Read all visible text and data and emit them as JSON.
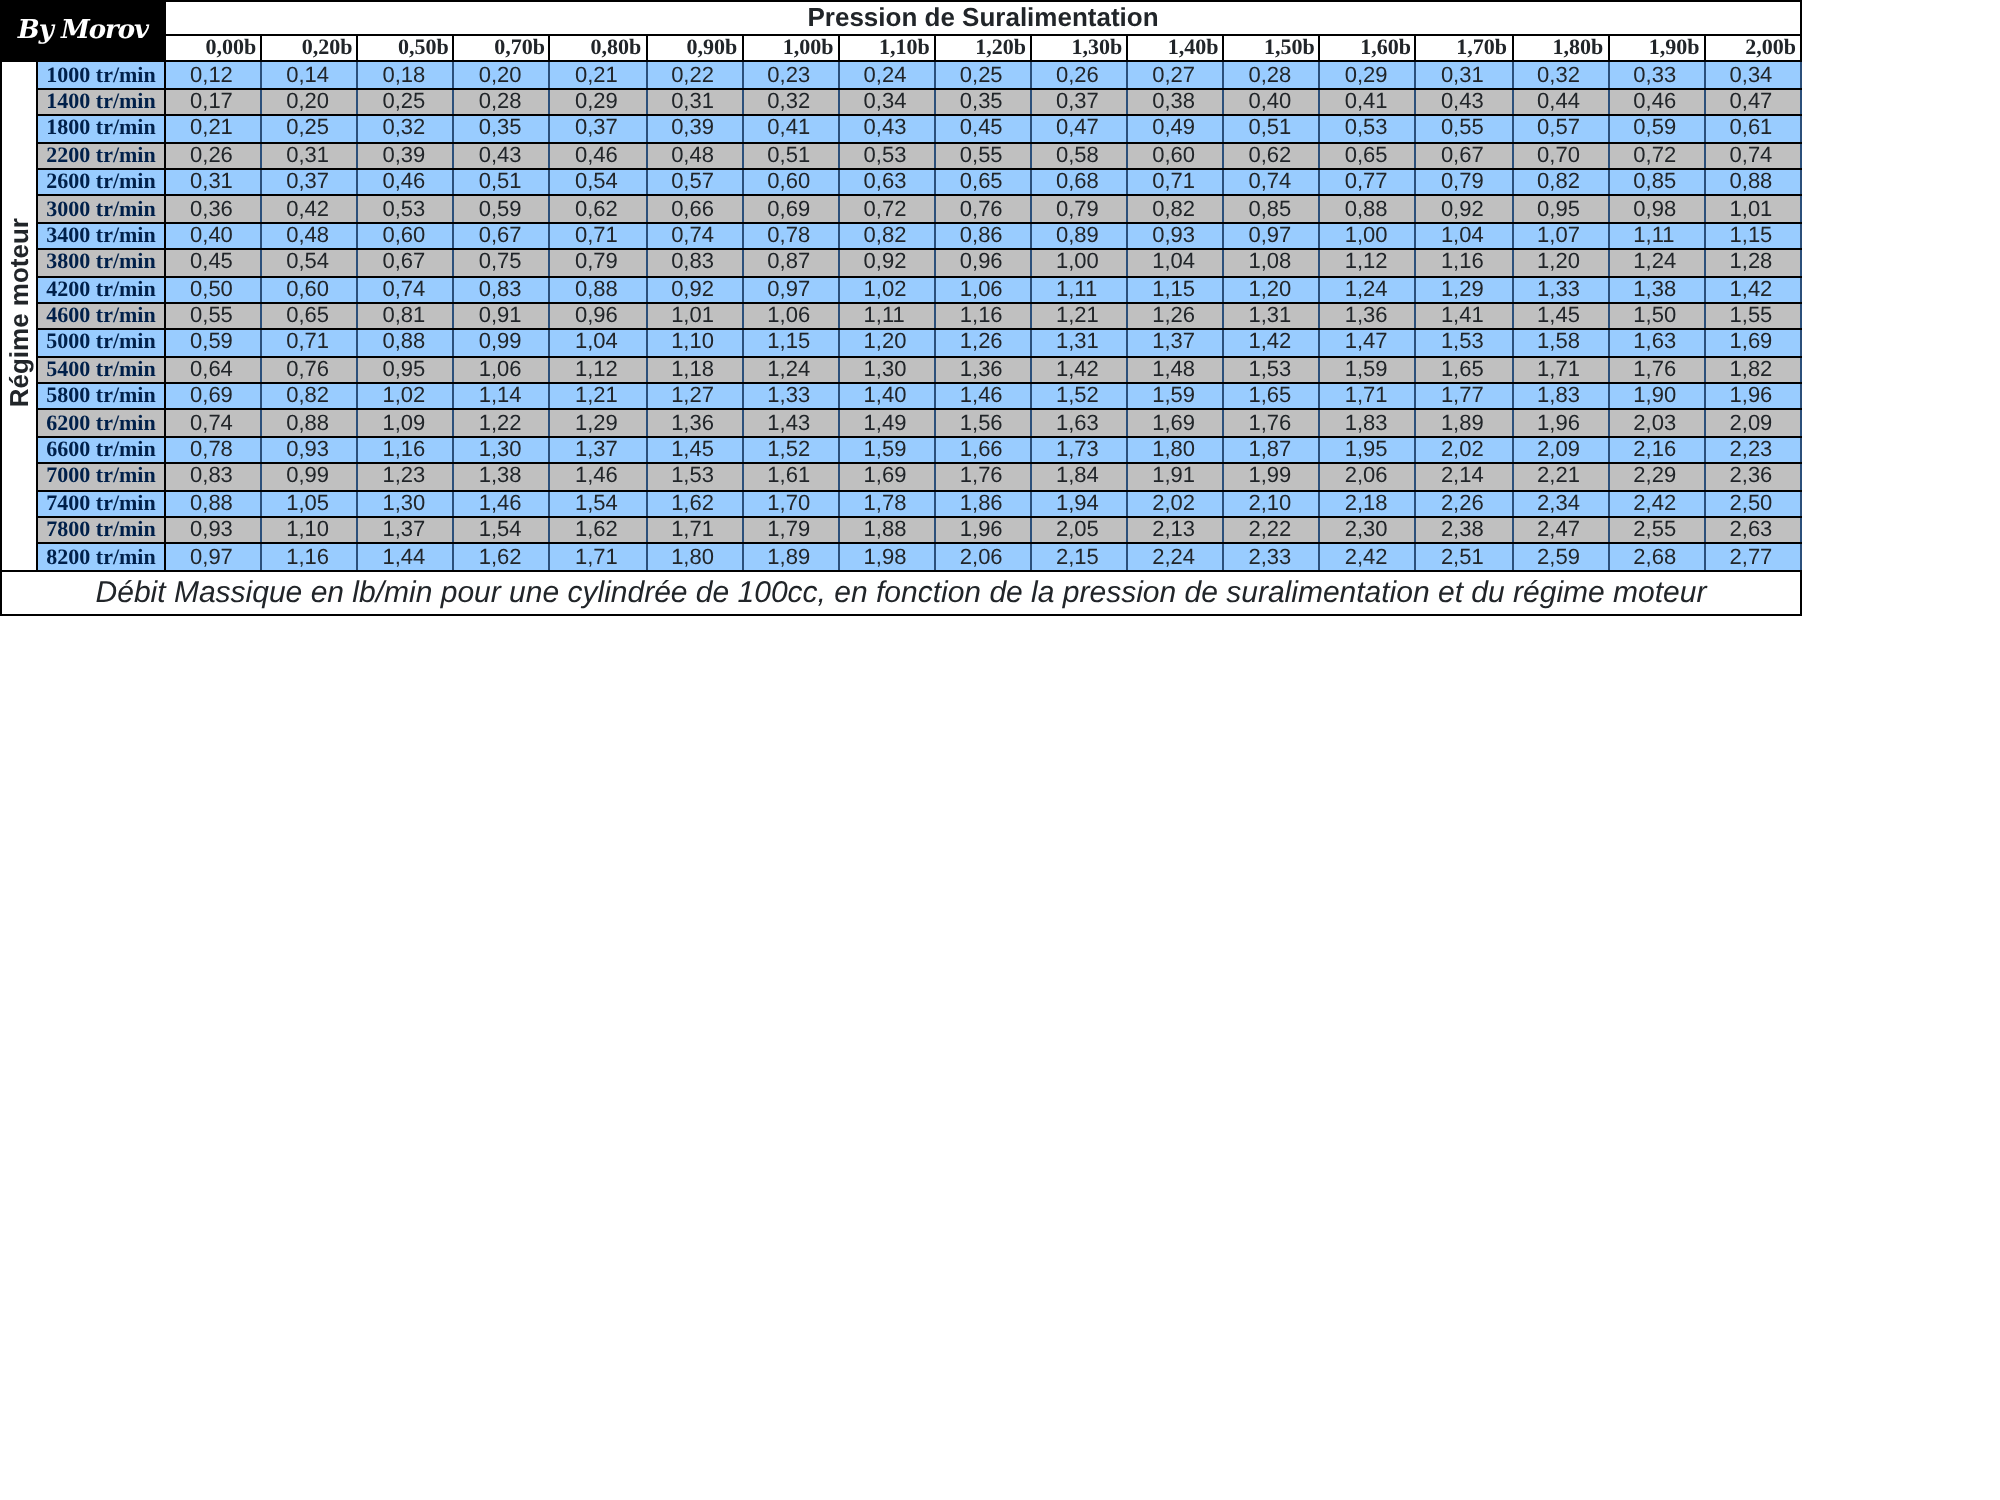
{
  "logo": "By Morov",
  "table": {
    "title": "Pression de Suralimentation",
    "row_axis_label": "Régime moteur",
    "columns": [
      "0,00b",
      "0,20b",
      "0,50b",
      "0,70b",
      "0,80b",
      "0,90b",
      "1,00b",
      "1,10b",
      "1,20b",
      "1,30b",
      "1,40b",
      "1,50b",
      "1,60b",
      "1,70b",
      "1,80b",
      "1,90b",
      "2,00b"
    ],
    "rows": [
      {
        "label": "1000 tr/min",
        "values": [
          "0,12",
          "0,14",
          "0,18",
          "0,20",
          "0,21",
          "0,22",
          "0,23",
          "0,24",
          "0,25",
          "0,26",
          "0,27",
          "0,28",
          "0,29",
          "0,31",
          "0,32",
          "0,33",
          "0,34"
        ]
      },
      {
        "label": "1400 tr/min",
        "values": [
          "0,17",
          "0,20",
          "0,25",
          "0,28",
          "0,29",
          "0,31",
          "0,32",
          "0,34",
          "0,35",
          "0,37",
          "0,38",
          "0,40",
          "0,41",
          "0,43",
          "0,44",
          "0,46",
          "0,47"
        ]
      },
      {
        "label": "1800 tr/min",
        "values": [
          "0,21",
          "0,25",
          "0,32",
          "0,35",
          "0,37",
          "0,39",
          "0,41",
          "0,43",
          "0,45",
          "0,47",
          "0,49",
          "0,51",
          "0,53",
          "0,55",
          "0,57",
          "0,59",
          "0,61"
        ]
      },
      {
        "label": "2200 tr/min",
        "values": [
          "0,26",
          "0,31",
          "0,39",
          "0,43",
          "0,46",
          "0,48",
          "0,51",
          "0,53",
          "0,55",
          "0,58",
          "0,60",
          "0,62",
          "0,65",
          "0,67",
          "0,70",
          "0,72",
          "0,74"
        ]
      },
      {
        "label": "2600 tr/min",
        "values": [
          "0,31",
          "0,37",
          "0,46",
          "0,51",
          "0,54",
          "0,57",
          "0,60",
          "0,63",
          "0,65",
          "0,68",
          "0,71",
          "0,74",
          "0,77",
          "0,79",
          "0,82",
          "0,85",
          "0,88"
        ]
      },
      {
        "label": "3000 tr/min",
        "values": [
          "0,36",
          "0,42",
          "0,53",
          "0,59",
          "0,62",
          "0,66",
          "0,69",
          "0,72",
          "0,76",
          "0,79",
          "0,82",
          "0,85",
          "0,88",
          "0,92",
          "0,95",
          "0,98",
          "1,01"
        ]
      },
      {
        "label": "3400 tr/min",
        "values": [
          "0,40",
          "0,48",
          "0,60",
          "0,67",
          "0,71",
          "0,74",
          "0,78",
          "0,82",
          "0,86",
          "0,89",
          "0,93",
          "0,97",
          "1,00",
          "1,04",
          "1,07",
          "1,11",
          "1,15"
        ]
      },
      {
        "label": "3800 tr/min",
        "values": [
          "0,45",
          "0,54",
          "0,67",
          "0,75",
          "0,79",
          "0,83",
          "0,87",
          "0,92",
          "0,96",
          "1,00",
          "1,04",
          "1,08",
          "1,12",
          "1,16",
          "1,20",
          "1,24",
          "1,28"
        ]
      },
      {
        "label": "4200 tr/min",
        "values": [
          "0,50",
          "0,60",
          "0,74",
          "0,83",
          "0,88",
          "0,92",
          "0,97",
          "1,02",
          "1,06",
          "1,11",
          "1,15",
          "1,20",
          "1,24",
          "1,29",
          "1,33",
          "1,38",
          "1,42"
        ]
      },
      {
        "label": "4600 tr/min",
        "values": [
          "0,55",
          "0,65",
          "0,81",
          "0,91",
          "0,96",
          "1,01",
          "1,06",
          "1,11",
          "1,16",
          "1,21",
          "1,26",
          "1,31",
          "1,36",
          "1,41",
          "1,45",
          "1,50",
          "1,55"
        ]
      },
      {
        "label": "5000 tr/min",
        "values": [
          "0,59",
          "0,71",
          "0,88",
          "0,99",
          "1,04",
          "1,10",
          "1,15",
          "1,20",
          "1,26",
          "1,31",
          "1,37",
          "1,42",
          "1,47",
          "1,53",
          "1,58",
          "1,63",
          "1,69"
        ]
      },
      {
        "label": "5400 tr/min",
        "values": [
          "0,64",
          "0,76",
          "0,95",
          "1,06",
          "1,12",
          "1,18",
          "1,24",
          "1,30",
          "1,36",
          "1,42",
          "1,48",
          "1,53",
          "1,59",
          "1,65",
          "1,71",
          "1,76",
          "1,82"
        ]
      },
      {
        "label": "5800 tr/min",
        "values": [
          "0,69",
          "0,82",
          "1,02",
          "1,14",
          "1,21",
          "1,27",
          "1,33",
          "1,40",
          "1,46",
          "1,52",
          "1,59",
          "1,65",
          "1,71",
          "1,77",
          "1,83",
          "1,90",
          "1,96"
        ]
      },
      {
        "label": "6200 tr/min",
        "values": [
          "0,74",
          "0,88",
          "1,09",
          "1,22",
          "1,29",
          "1,36",
          "1,43",
          "1,49",
          "1,56",
          "1,63",
          "1,69",
          "1,76",
          "1,83",
          "1,89",
          "1,96",
          "2,03",
          "2,09"
        ]
      },
      {
        "label": "6600 tr/min",
        "values": [
          "0,78",
          "0,93",
          "1,16",
          "1,30",
          "1,37",
          "1,45",
          "1,52",
          "1,59",
          "1,66",
          "1,73",
          "1,80",
          "1,87",
          "1,95",
          "2,02",
          "2,09",
          "2,16",
          "2,23"
        ]
      },
      {
        "label": "7000 tr/min",
        "values": [
          "0,83",
          "0,99",
          "1,23",
          "1,38",
          "1,46",
          "1,53",
          "1,61",
          "1,69",
          "1,76",
          "1,84",
          "1,91",
          "1,99",
          "2,06",
          "2,14",
          "2,21",
          "2,29",
          "2,36"
        ]
      },
      {
        "label": "7400 tr/min",
        "values": [
          "0,88",
          "1,05",
          "1,30",
          "1,46",
          "1,54",
          "1,62",
          "1,70",
          "1,78",
          "1,86",
          "1,94",
          "2,02",
          "2,10",
          "2,18",
          "2,26",
          "2,34",
          "2,42",
          "2,50"
        ]
      },
      {
        "label": "7800 tr/min",
        "values": [
          "0,93",
          "1,10",
          "1,37",
          "1,54",
          "1,62",
          "1,71",
          "1,79",
          "1,88",
          "1,96",
          "2,05",
          "2,13",
          "2,22",
          "2,30",
          "2,38",
          "2,47",
          "2,55",
          "2,63"
        ]
      },
      {
        "label": "8200 tr/min",
        "values": [
          "0,97",
          "1,16",
          "1,44",
          "1,62",
          "1,71",
          "1,80",
          "1,89",
          "1,98",
          "2,06",
          "2,15",
          "2,24",
          "2,33",
          "2,42",
          "2,51",
          "2,59",
          "2,68",
          "2,77"
        ]
      }
    ]
  },
  "caption": "Débit Massique en lb/min pour une cylindrée de 100cc, en fonction de la pression de suralimentation et du régime moteur"
}
